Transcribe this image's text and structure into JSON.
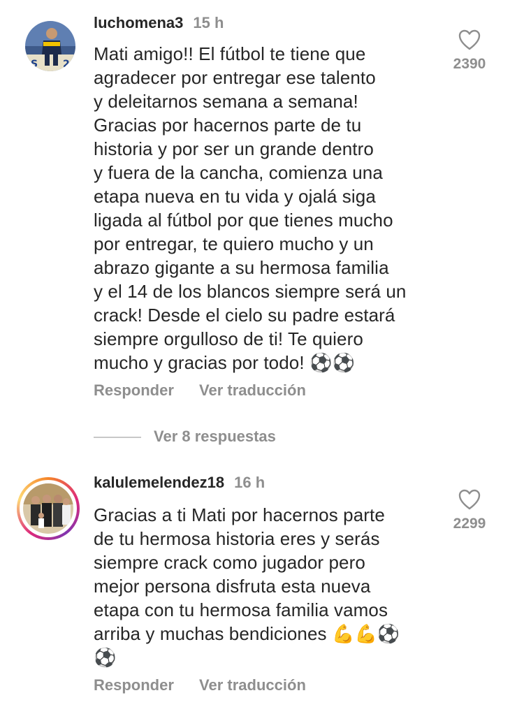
{
  "comments": [
    {
      "username": "luchomena3",
      "time": "15 h",
      "avatar_icon": "profile-photo",
      "lines": [
        "Mati amigo!! El fútbol te tiene que",
        "agradecer por entregar ese talento",
        "y deleitarnos semana a semana!",
        "Gracias por hacernos parte de tu",
        "historia y por ser un grande dentro",
        "y fuera de la cancha, comienza una",
        "etapa nueva en tu vida y ojalá siga",
        "ligada al fútbol por que tienes mucho",
        "por entregar, te quiero mucho y un",
        "abrazo gigante a su hermosa familia",
        "y el 14 de los blancos siempre será un",
        "crack! Desde el cielo su padre estará",
        "siempre orgulloso de ti! Te quiero",
        "mucho y gracias por todo! ⚽⚽"
      ],
      "likes": "2390",
      "reply_label": "Responder",
      "translate_label": "Ver traducción",
      "view_replies": "Ver 8 respuestas"
    },
    {
      "username": "kalulemelendez18",
      "time": "16 h",
      "avatar_icon": "profile-photo-story-ring",
      "lines": [
        "Gracias a ti Mati por hacernos parte",
        "de tu hermosa historia eres y serás",
        "siempre crack como jugador pero",
        "mejor persona disfruta esta nueva",
        "etapa con tu hermosa familia  vamos",
        "arriba y muchas bendiciones 💪💪⚽",
        "⚽"
      ],
      "likes": "2299",
      "reply_label": "Responder",
      "translate_label": "Ver traducción"
    }
  ],
  "colors": {
    "text": "#262626",
    "secondary": "#8e8e8e",
    "divider": "#c7c7c7"
  }
}
